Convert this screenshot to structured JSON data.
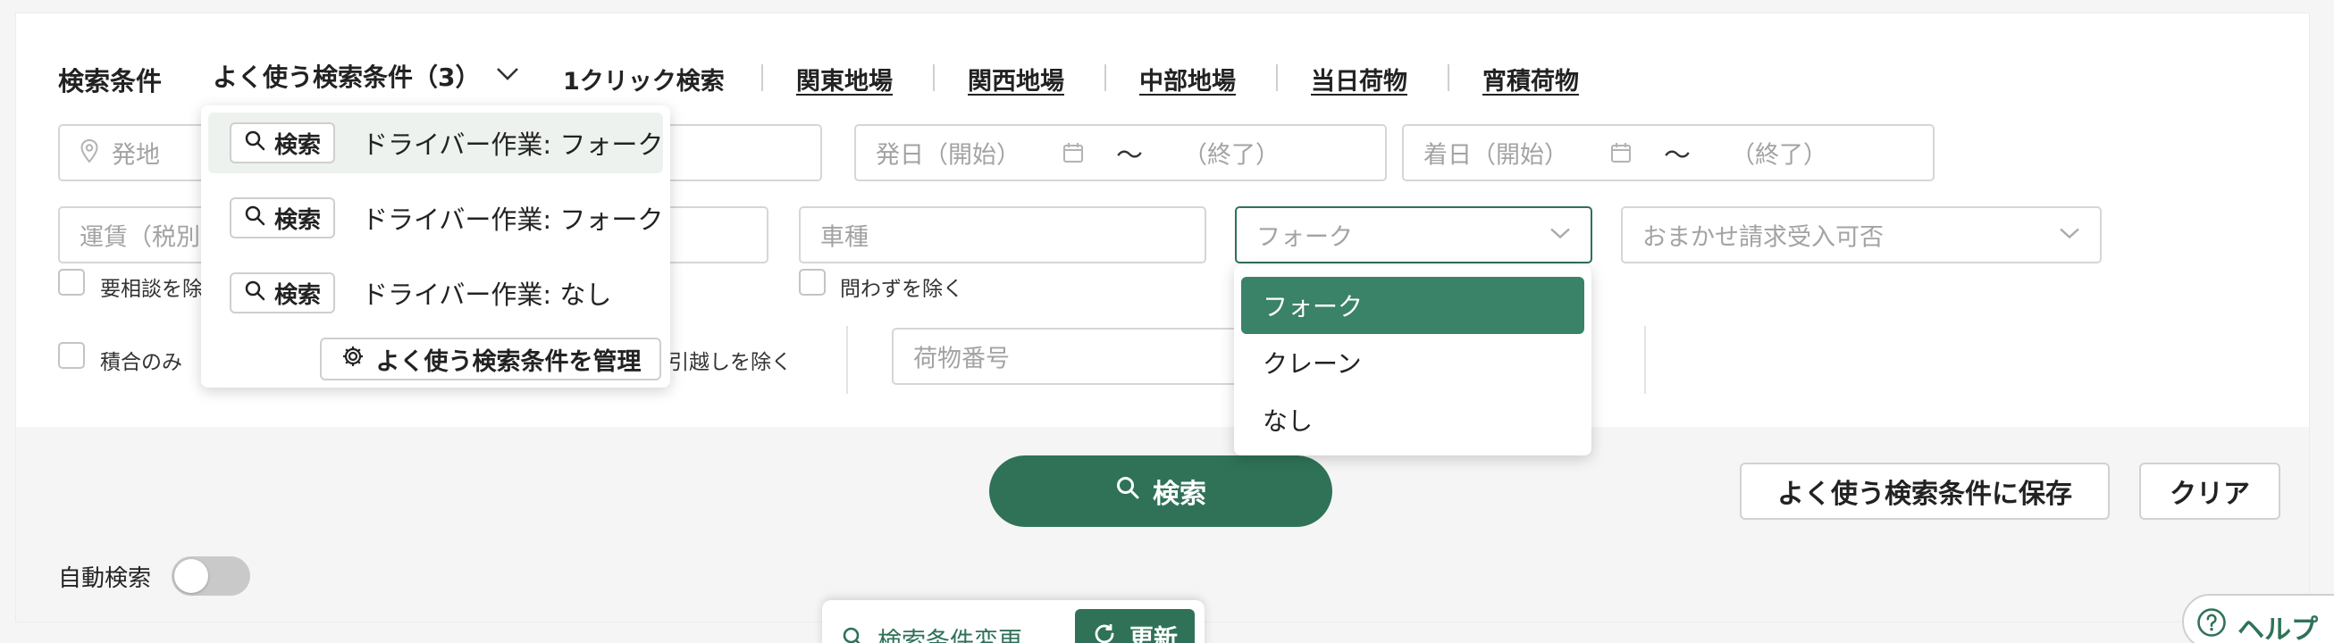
{
  "header": {
    "title": "検索条件",
    "favorites_label": "よく使う検索条件（3）",
    "one_click_label": "1クリック検索",
    "quick_links": [
      "関東地場",
      "関西地場",
      "中部地場",
      "当日荷物",
      "宵積荷物"
    ]
  },
  "fields": {
    "origin_placeholder": "発地",
    "depart_start_placeholder": "発日（開始）",
    "depart_end_placeholder": "（終了）",
    "arrive_start_placeholder": "着日（開始）",
    "arrive_end_placeholder": "（終了）",
    "range_sep": "〜",
    "fare_placeholder": "運賃（税別",
    "vehicle_placeholder": "車種",
    "work_selected": "フォーク",
    "auto_invoice_placeholder": "おまかせ請求受入可否",
    "cargo_number_placeholder": "荷物番号"
  },
  "checkboxes": {
    "consult_exclude": "要相談を除",
    "any_exclude": "問わずを除く",
    "mixed_only": "積合のみ",
    "moving_exclude": "引越しを除く"
  },
  "favorites_menu": {
    "chip_label": "検索",
    "items": [
      "ドライバー作業: フォーク",
      "ドライバー作業: フォーク",
      "ドライバー作業: なし"
    ],
    "manage_label": "よく使う検索条件を管理"
  },
  "work_dropdown": {
    "options": [
      "フォーク",
      "クレーン",
      "なし"
    ],
    "selected": "フォーク"
  },
  "actions": {
    "search_label": "検索",
    "save_favorite_label": "よく使う検索条件に保存",
    "clear_label": "クリア",
    "auto_search_label": "自動検索",
    "auto_search_on": false
  },
  "bottom_bar": {
    "change_label": "検索条件変更",
    "refresh_label": "更新"
  },
  "help": {
    "label": "ヘルプ"
  },
  "colors": {
    "primary": "#2f7258",
    "option_selected": "#3a8268",
    "menu_hover": "#eef2ef"
  }
}
